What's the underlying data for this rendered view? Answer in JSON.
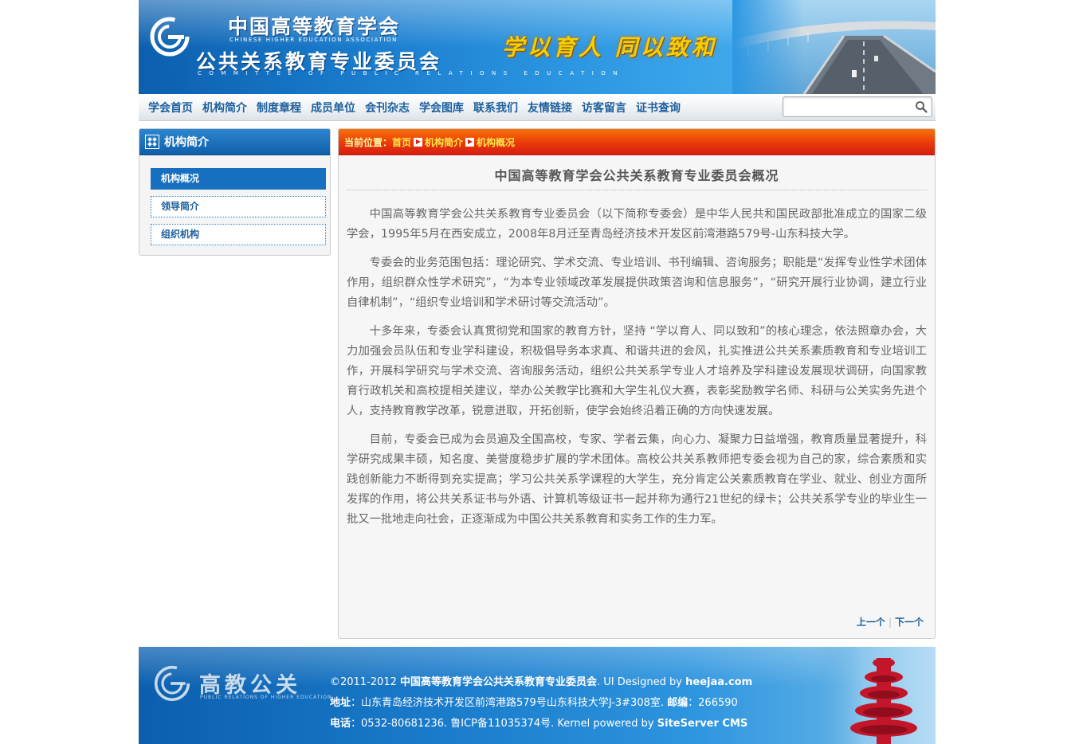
{
  "header": {
    "org_cn": "中国高等教育学会",
    "org_en": "CHINESE HIGHER EDUCATION ASSOCIATION",
    "committee_cn": "公共关系教育专业委员会",
    "committee_en": "COMMITTEE OF PUBLIC RELATIONS EDUCATION",
    "slogan": "学以育人 同以致和"
  },
  "nav": {
    "items": [
      "学会首页",
      "机构简介",
      "制度章程",
      "成员单位",
      "会刊杂志",
      "学会图库",
      "联系我们",
      "友情链接",
      "访客留言",
      "证书查询"
    ],
    "search_value": ""
  },
  "sidebar": {
    "title": "机构简介",
    "items": [
      "机构概况",
      "领导简介",
      "组织机构"
    ]
  },
  "breadcrumb": {
    "label": "当前位置：",
    "items": [
      "首页",
      "机构简介",
      "机构概况"
    ]
  },
  "article": {
    "title": "中国高等教育学会公共关系教育专业委员会概况",
    "paragraphs": [
      "中国高等教育学会公共关系教育专业委员会（以下简称专委会）是中华人民共和国民政部批准成立的国家二级学会，1995年5月在西安成立，2008年8月迁至青岛经济技术开发区前湾港路579号-山东科技大学。",
      "专委会的业务范围包括：理论研究、学术交流、专业培训、书刊编辑、咨询服务；职能是“发挥专业性学术团体作用，组织群众性学术研究”，“为本专业领域改革发展提供政策咨询和信息服务”，“研究开展行业协调，建立行业自律机制”，“组织专业培训和学术研讨等交流活动”。",
      "十多年来，专委会认真贯彻党和国家的教育方针，坚持 “学以育人、同以致和”的核心理念，依法照章办会，大力加强会员队伍和专业学科建设，积极倡导务本求真、和谐共进的会风，扎实推进公共关系素质教育和专业培训工作，开展科学研究与学术交流、咨询服务活动，组织公共关系学专业人才培养及学科建设发展现状调研，向国家教育行政机关和高校提相关建议，举办公关教学比赛和大学生礼仪大赛，表彰奖励教学名师、科研与公关实务先进个人，支持教育教学改革，锐意进取，开拓创新，使学会始终沿着正确的方向快速发展。",
      "目前，专委会已成为会员遍及全国高校，专家、学者云集，向心力、凝聚力日益增强，教育质量显著提升，科学研究成果丰硕，知名度、美誉度稳步扩展的学术团体。高校公共关系教师把专委会视为自己的家，综合素质和实践创新能力不断得到充实提高；学习公共关系学课程的大学生，充分肯定公关素质教育在学业、就业、创业方面所发挥的作用，将公共关系证书与外语、计算机等级证书一起并称为通行21世纪的绿卡；公共关系学专业的毕业生一批又一批地走向社会，正逐渐成为中国公共关系教育和实务工作的生力军。"
    ],
    "prev": "上一个",
    "next": "下一个",
    "pager_sep": "|"
  },
  "footer": {
    "brand_cn": "高教公关",
    "brand_en": "PUBLIC RELATIONS OF HIGHER EDUCATION",
    "copyright": "©2011-2012",
    "org_name": "中国高等教育学会公共关系教育专业委员会",
    "designed_by_label": ".   UI Designed by",
    "designer": "heejaa.com",
    "address_label": "地址",
    "address": "：山东青岛经济技术开发区前湾港路579号山东科技大学J-3#308室. ",
    "postcode_label": "邮编",
    "postcode": "：266590",
    "phone_label": "电话",
    "phone": "：0532-80681236. 鲁ICP备11035374号. Kernel powered by ",
    "cms": "SiteServer CMS"
  },
  "colors": {
    "brand_blue": "#176fc0",
    "nav_link": "#1d5f9d",
    "breadcrumb_red": "#e23a0d",
    "breadcrumb_link": "#ffe94a",
    "slogan_gold": "#f5d000"
  }
}
